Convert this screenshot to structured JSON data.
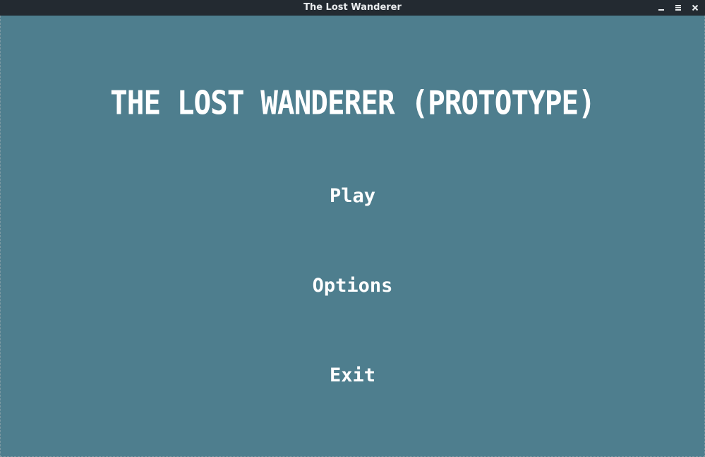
{
  "window": {
    "title": "The Lost Wanderer"
  },
  "titlebar_icons": [
    "minimize-icon",
    "maximize-icon",
    "close-icon"
  ],
  "game": {
    "title": "THE LOST WANDERER (PROTOTYPE)",
    "menu": {
      "play_label": "Play",
      "options_label": "Options",
      "exit_label": "Exit"
    }
  },
  "colors": {
    "background": "#4e7e8e",
    "titlebar": "#232a31",
    "text": "#ffffff"
  }
}
